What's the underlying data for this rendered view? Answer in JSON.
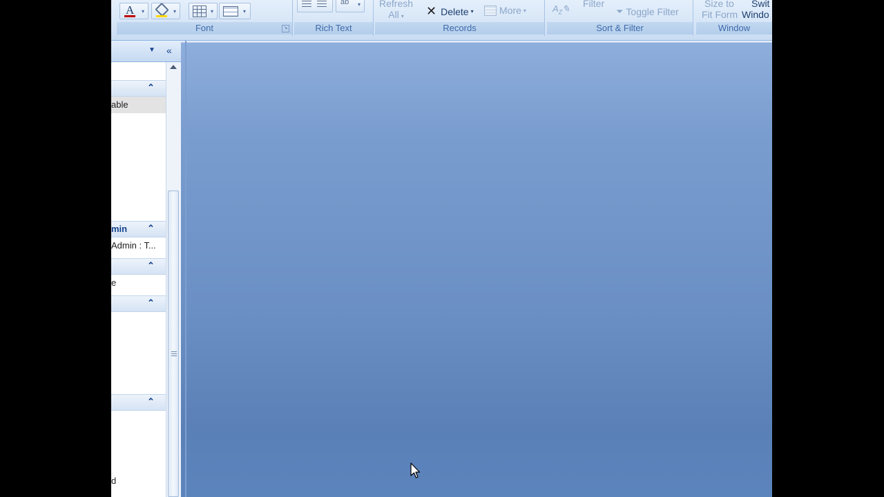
{
  "ribbon": {
    "groups": {
      "font": {
        "label": "Font"
      },
      "rich_text": {
        "label": "Rich Text"
      },
      "records": {
        "label": "Records",
        "refresh_line1": "Refresh",
        "refresh_line2": "All",
        "delete": "Delete",
        "more": "More"
      },
      "sort_filter": {
        "label": "Sort & Filter",
        "filter": "Filter",
        "toggle_filter": "Toggle Filter"
      },
      "window": {
        "label": "Window",
        "size_to_line1": "Size to",
        "size_to_line2": "Fit Form",
        "switch_line1": "Swit",
        "switch_line2": "Windo"
      }
    }
  },
  "nav": {
    "section1_item": "able",
    "section2_title": "min",
    "section2_item": "Admin : T...",
    "section3_item": "e",
    "bottom_item": "d"
  },
  "colors": {
    "ribbon_bg": "#d7e6f7",
    "workspace_top": "#8eaedc",
    "workspace_bottom": "#5a80b7"
  }
}
